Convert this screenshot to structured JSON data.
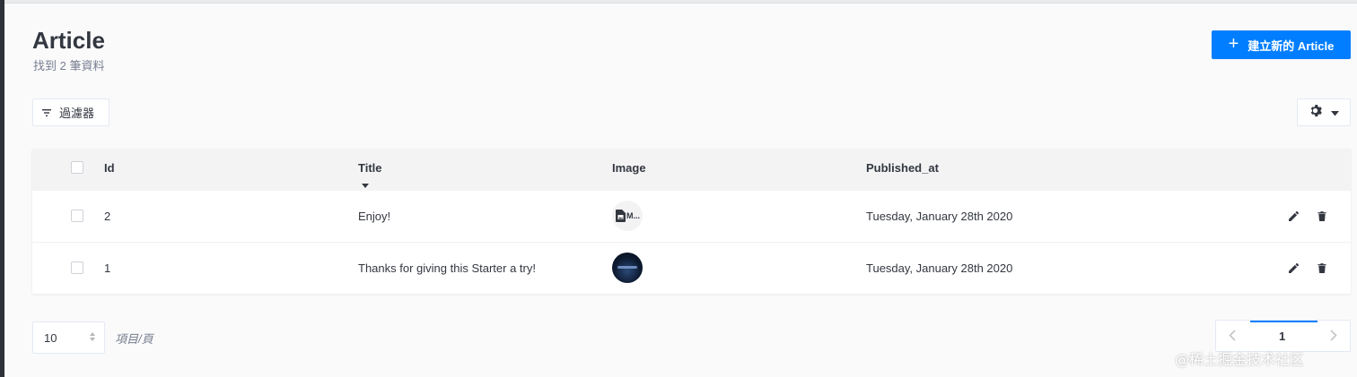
{
  "header": {
    "title": "Article",
    "count_text": "找到 2 筆資料",
    "create_label": "建立新的 Article"
  },
  "toolbar": {
    "filter_label": "過濾器"
  },
  "table": {
    "columns": [
      "Id",
      "Title",
      "Image",
      "Published_at"
    ],
    "sorted_column": "Title",
    "rows": [
      {
        "id": "2",
        "title": "Enjoy!",
        "image": "file",
        "image_text": "M...",
        "published_at": "Tuesday, January 28th 2020"
      },
      {
        "id": "1",
        "title": "Thanks for giving this Starter a try!",
        "image": "photo",
        "published_at": "Tuesday, January 28th 2020"
      }
    ]
  },
  "footer": {
    "per_page_value": "10",
    "per_page_label": "項目/頁",
    "current_page": "1"
  },
  "watermark": "@稀土掘金技术社区",
  "colors": {
    "accent": "#007eff",
    "background": "#fafafb",
    "sidebar": "#2d3138"
  }
}
